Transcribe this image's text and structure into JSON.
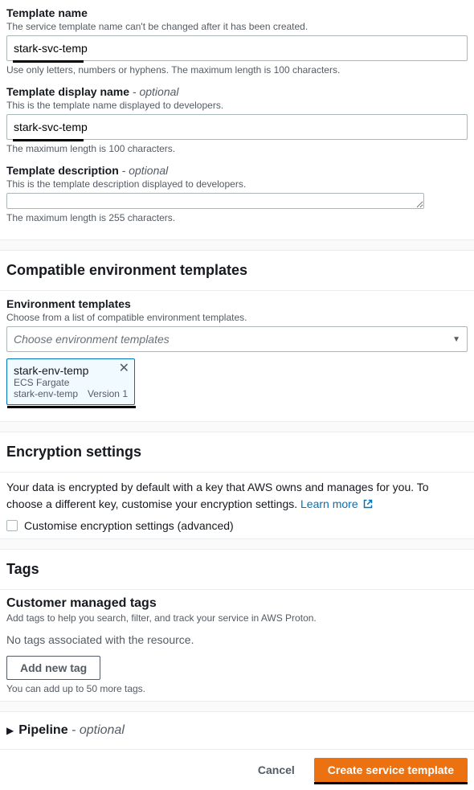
{
  "templateName": {
    "label": "Template name",
    "help": "The service template name can't be changed after it has been created.",
    "value": "stark-svc-temp",
    "constraint": "Use only letters, numbers or hyphens. The maximum length is 100 characters."
  },
  "templateDisplayName": {
    "label": "Template display name",
    "optional": "- optional",
    "help": "This is the template name displayed to developers.",
    "value": "stark-svc-temp",
    "constraint": "The maximum length is 100 characters."
  },
  "templateDescription": {
    "label": "Template description",
    "optional": "- optional",
    "help": "This is the template description displayed to developers.",
    "value": "",
    "constraint": "The maximum length is 255 characters."
  },
  "compatibleEnv": {
    "heading": "Compatible environment templates",
    "subLabel": "Environment templates",
    "subHelp": "Choose from a list of compatible environment templates.",
    "dropdownPlaceholder": "Choose environment templates",
    "selected": {
      "name": "stark-env-temp",
      "type": "ECS Fargate",
      "id": "stark-env-temp",
      "version": "Version 1"
    }
  },
  "encryption": {
    "heading": "Encryption settings",
    "text": "Your data is encrypted by default with a key that AWS owns and manages for you. To choose a different key, customise your encryption settings. ",
    "learnMore": "Learn more",
    "checkboxLabel": "Customise encryption settings (advanced)"
  },
  "tags": {
    "heading": "Tags",
    "subHeading": "Customer managed tags",
    "subHelp": "Add tags to help you search, filter, and track your service in AWS Proton.",
    "empty": "No tags associated with the resource.",
    "addButton": "Add new tag",
    "limit": "You can add up to 50 more tags."
  },
  "pipeline": {
    "label": "Pipeline",
    "optional": "- optional"
  },
  "footer": {
    "cancel": "Cancel",
    "submit": "Create service template"
  }
}
